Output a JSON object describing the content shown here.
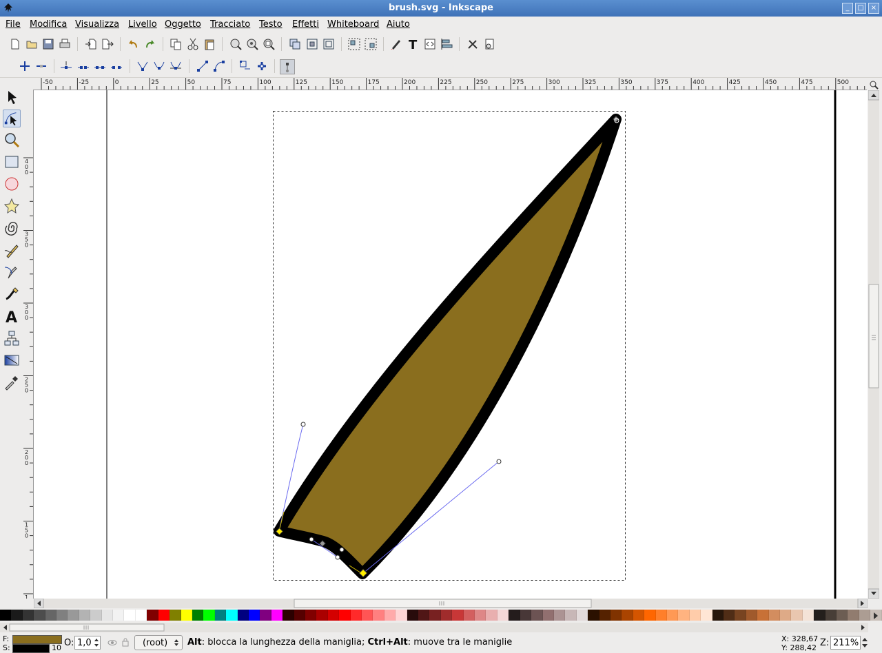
{
  "window": {
    "title": "brush.svg - Inkscape",
    "controls": [
      "minimize-icon",
      "maximize-icon",
      "close-icon"
    ]
  },
  "menu": {
    "items": [
      "File",
      "Modifica",
      "Visualizza",
      "Livello",
      "Oggetto",
      "Tracciato",
      "Testo",
      "Effetti",
      "Whiteboard",
      "Aiuto"
    ]
  },
  "toolbar": {
    "commands": [
      "new-icon",
      "open-icon",
      "save-icon",
      "print-icon",
      "import-icon",
      "export-icon",
      "undo-icon",
      "redo-icon",
      "copy-icon",
      "cut-icon",
      "paste-icon",
      "zoom-selection-icon",
      "zoom-drawing-icon",
      "zoom-page-icon",
      "duplicate-icon",
      "clone-icon",
      "unlink-clone-icon",
      "group-icon",
      "ungroup-icon",
      "fill-stroke-icon",
      "text-icon",
      "xml-editor-icon",
      "align-icon",
      "preferences-icon",
      "document-properties-icon"
    ],
    "node_tools": [
      "insert-node-icon",
      "delete-node-icon",
      "join-nodes-icon",
      "break-path-icon",
      "join-segment-icon",
      "delete-segment-icon",
      "cusp-node-icon",
      "smooth-node-icon",
      "symmetric-node-icon",
      "line-segment-icon",
      "curve-segment-icon",
      "object-to-path-icon",
      "stroke-to-path-icon",
      "show-handles-icon"
    ]
  },
  "rulers": {
    "top_labels": [
      "-50",
      "-25",
      "0",
      "25",
      "50",
      "75",
      "100",
      "125",
      "150",
      "175",
      "200",
      "225",
      "250",
      "275",
      "300",
      "325",
      "350",
      "375",
      "400",
      "425",
      "450",
      "475",
      "500"
    ],
    "left_labels": [
      "4\n0\n0",
      "3\n5\n0",
      "3\n0\n0",
      "2\n5\n0",
      "2\n0\n0",
      "1\n5\n0",
      "1"
    ]
  },
  "toolbox": {
    "tools": [
      "selector-tool-icon",
      "node-tool-icon",
      "zoom-tool-icon",
      "rectangle-tool-icon",
      "ellipse-tool-icon",
      "star-tool-icon",
      "spiral-tool-icon",
      "pencil-tool-icon",
      "pen-tool-icon",
      "calligraphy-tool-icon",
      "text-tool-icon",
      "connector-tool-icon",
      "gradient-tool-icon",
      "dropper-tool-icon"
    ],
    "active": "node-tool-icon"
  },
  "drawing": {
    "fill_color": "#8a6e1e",
    "stroke_color": "#000000",
    "handle_color": "#6a6af0",
    "selected_node_color": "#ffee00"
  },
  "palette": {
    "colors": [
      "#000000",
      "#1a1a1a",
      "#333333",
      "#4d4d4d",
      "#666666",
      "#808080",
      "#999999",
      "#b3b3b3",
      "#cccccc",
      "#e6e6e6",
      "#f2f2f2",
      "#ffffff",
      "#ffffff",
      "#800000",
      "#ff0000",
      "#808000",
      "#ffff00",
      "#008000",
      "#00ff00",
      "#008080",
      "#00ffff",
      "#000080",
      "#0000ff",
      "#800080",
      "#ff00ff",
      "#2b0000",
      "#550000",
      "#800000",
      "#aa0000",
      "#d40000",
      "#ff0000",
      "#ff2a2a",
      "#ff5555",
      "#ff8080",
      "#ffaaaa",
      "#ffd5d5",
      "#280b0b",
      "#501616",
      "#782121",
      "#a02c2c",
      "#c83737",
      "#d35f5f",
      "#de8787",
      "#e9afaf",
      "#f4d7d7",
      "#241c1c",
      "#483737",
      "#6c5353",
      "#916f6f",
      "#ac9393",
      "#c8b7b7",
      "#e3dbdb",
      "#2b1100",
      "#552200",
      "#803300",
      "#aa4400",
      "#d45500",
      "#ff6600",
      "#ff7f2a",
      "#ff9955",
      "#ffb380",
      "#ffccaa",
      "#ffe6d5",
      "#28170b",
      "#502d16",
      "#784421",
      "#a05a2c",
      "#c87137",
      "#d38d5f",
      "#deaa87",
      "#e9c6af",
      "#f4e3d7",
      "#241f1c",
      "#483e37",
      "#6c5d53",
      "#917c6f",
      "#ac9d93",
      "#c8beb7"
    ]
  },
  "status": {
    "fill_label": "F:",
    "stroke_label": "S:",
    "stroke_width": "10",
    "opacity_label": "O:",
    "opacity_value": "1,0",
    "layer": "(root)",
    "message_alt_key": "Alt",
    "message_alt_text": ": blocca la lunghezza della maniglia; ",
    "message_ctrlalt_key": "Ctrl+Alt",
    "message_ctrlalt_text": ": muove tra le maniglie",
    "x_coord": "X: 328,67",
    "y_coord": "Y: 288,42",
    "zoom_label": "Z:",
    "zoom_value": "211%"
  }
}
